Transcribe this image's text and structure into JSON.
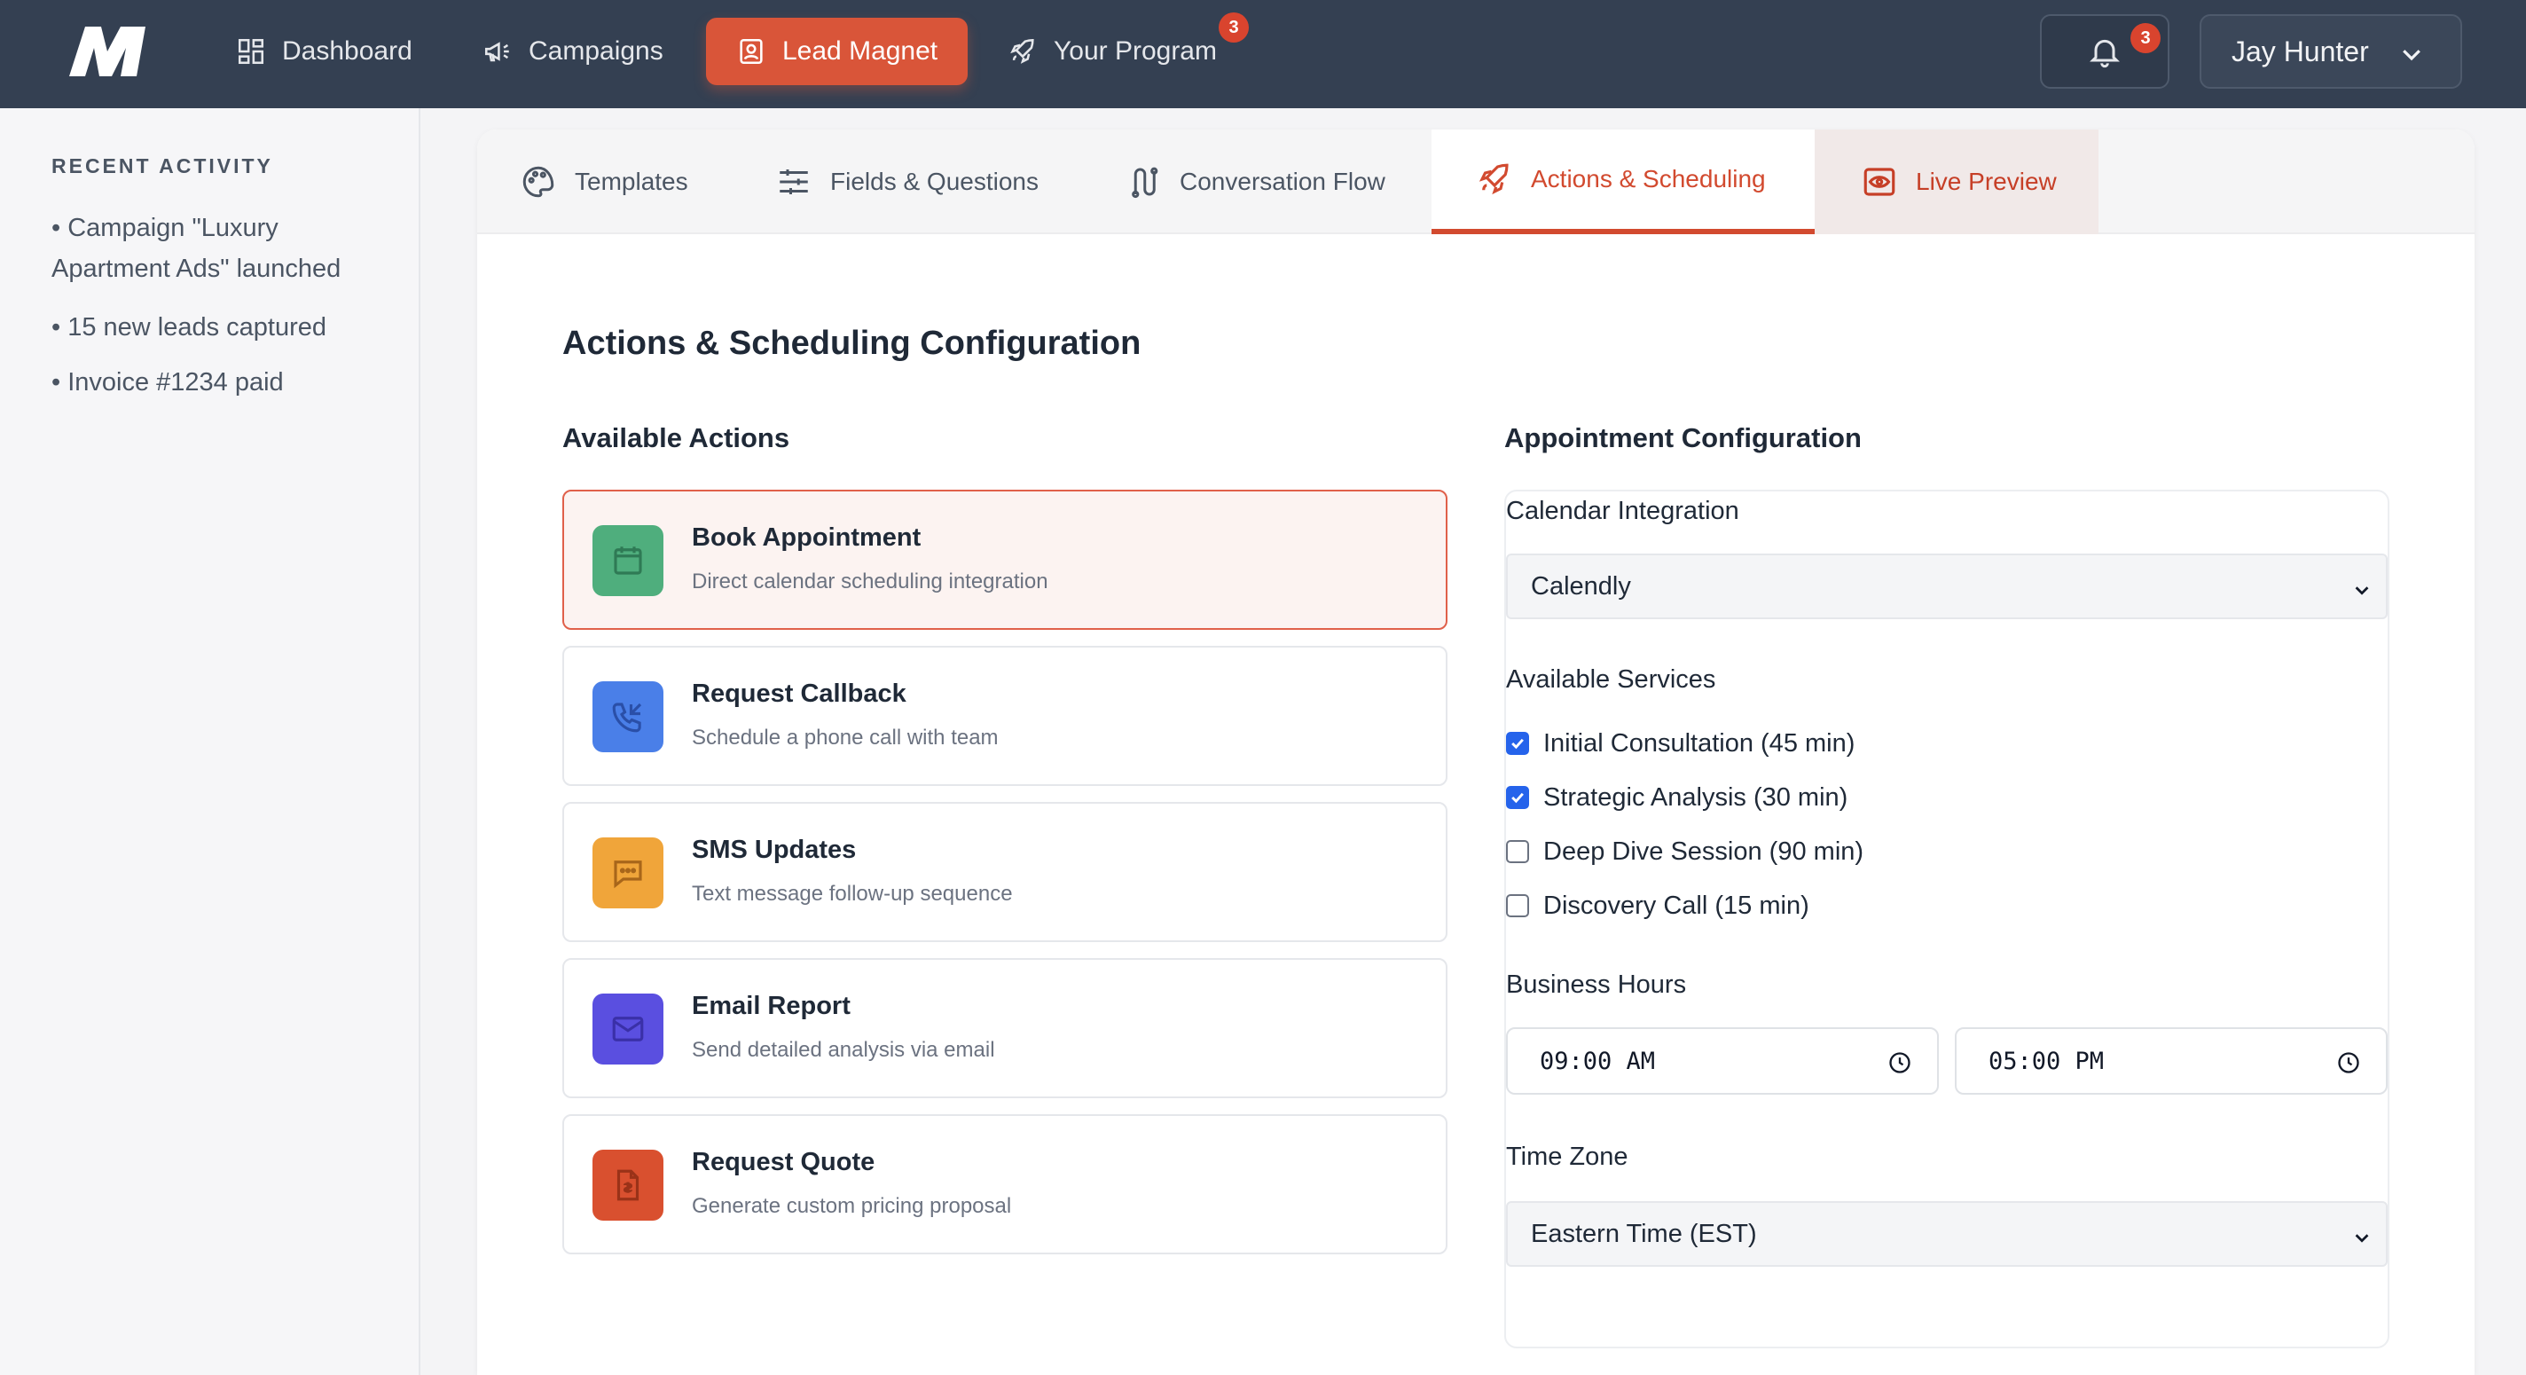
{
  "nav": {
    "items": [
      {
        "label": "Dashboard",
        "icon": "dashboard-icon"
      },
      {
        "label": "Campaigns",
        "icon": "megaphone-icon"
      },
      {
        "label": "Lead Magnet",
        "icon": "contact-card-icon",
        "active": true
      },
      {
        "label": "Your Program",
        "icon": "rocket-icon",
        "badge": "3"
      }
    ],
    "notifications_badge": "3",
    "user_name": "Jay Hunter"
  },
  "sidebar": {
    "title": "RECENT ACTIVITY",
    "items": [
      "• Campaign \"Luxury Apartment Ads\" launched",
      "• 15 new leads captured",
      "• Invoice #1234 paid"
    ]
  },
  "tabs": [
    {
      "label": "Templates",
      "icon": "palette-icon"
    },
    {
      "label": "Fields & Questions",
      "icon": "sliders-icon"
    },
    {
      "label": "Conversation Flow",
      "icon": "flow-icon"
    },
    {
      "label": "Actions & Scheduling",
      "icon": "rocket-icon",
      "active": true
    },
    {
      "label": "Live Preview",
      "icon": "eye-icon"
    }
  ],
  "main": {
    "title": "Actions & Scheduling Configuration",
    "actions_title": "Available Actions",
    "actions": [
      {
        "name": "Book Appointment",
        "desc": "Direct calendar scheduling integration",
        "color": "#4fae7d",
        "icon": "calendar-icon",
        "selected": true
      },
      {
        "name": "Request Callback",
        "desc": "Schedule a phone call with team",
        "color": "#4a7fe8",
        "icon": "phone-callback-icon"
      },
      {
        "name": "SMS Updates",
        "desc": "Text message follow-up sequence",
        "color": "#f0a53a",
        "icon": "chat-icon"
      },
      {
        "name": "Email Report",
        "desc": "Send detailed analysis via email",
        "color": "#5a4fe0",
        "icon": "mail-icon"
      },
      {
        "name": "Request Quote",
        "desc": "Generate custom pricing proposal",
        "color": "#d9502f",
        "icon": "document-icon"
      }
    ],
    "config_title": "Appointment Configuration",
    "calendar_label": "Calendar Integration",
    "calendar_value": "Calendly",
    "services_label": "Available Services",
    "services": [
      {
        "label": "Initial Consultation (45 min)",
        "checked": true
      },
      {
        "label": "Strategic Analysis (30 min)",
        "checked": true
      },
      {
        "label": "Deep Dive Session (90 min)",
        "checked": false
      },
      {
        "label": "Discovery Call (15 min)",
        "checked": false
      }
    ],
    "hours_label": "Business Hours",
    "hours_start": "09:00  AM",
    "hours_end": "05:00  PM",
    "timezone_label": "Time Zone",
    "timezone_value": "Eastern Time (EST)"
  }
}
